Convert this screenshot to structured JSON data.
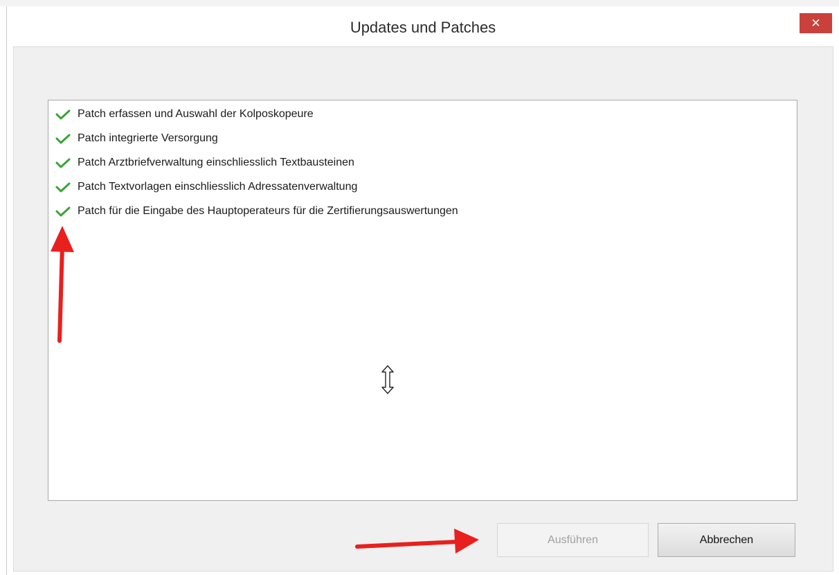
{
  "window": {
    "title": "Updates und Patches",
    "close_label": "✕"
  },
  "patches": [
    {
      "label": "Patch erfassen und Auswahl der Kolposkopeure",
      "status": "installed"
    },
    {
      "label": "Patch integrierte Versorgung",
      "status": "installed"
    },
    {
      "label": "Patch Arztbriefverwaltung einschliesslich Textbausteinen",
      "status": "installed"
    },
    {
      "label": "Patch Textvorlagen einschliesslich Adressatenverwaltung",
      "status": "installed"
    },
    {
      "label": "Patch für die Eingabe des Hauptoperateurs für die Zertifierungsauswertungen",
      "status": "installed"
    }
  ],
  "buttons": {
    "run_label": "Ausführen",
    "run_enabled": false,
    "cancel_label": "Abbrechen"
  },
  "colors": {
    "check": "#3aa335",
    "close": "#c9413a",
    "annotation_arrow": "#e8201e"
  },
  "icons": {
    "check": "check-icon",
    "close": "close-icon",
    "cursor": "resize-vertical-cursor-icon"
  }
}
